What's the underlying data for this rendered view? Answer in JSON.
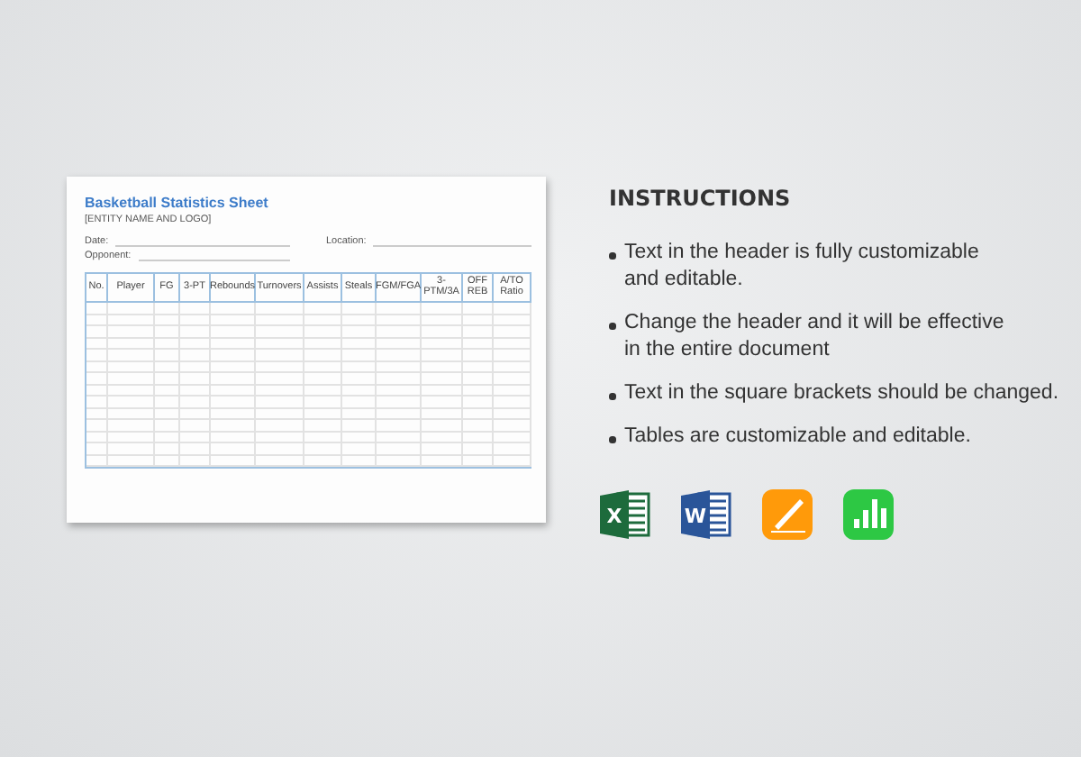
{
  "sheet": {
    "title": "Basketball Statistics Sheet",
    "subtitle": "[ENTITY NAME AND LOGO]",
    "fields": [
      {
        "label": "Date:"
      },
      {
        "label": "Location:"
      },
      {
        "label": "Opponent:"
      }
    ],
    "table": {
      "columns": [
        "No.",
        "Player",
        "FG",
        "3-PT",
        "Rebounds",
        "Turnovers",
        "Assists",
        "Steals",
        "FGM/FGA",
        "3-PTM/3A",
        "OFF REB",
        "A/TO Ratio"
      ]
    }
  },
  "instructions": {
    "title": "INSTRUCTIONS",
    "items": [
      [
        "Text in the header is fully customizable",
        "and editable."
      ],
      [
        "Change the header and it will be effective",
        "in the entire document"
      ],
      [
        "Text in the square brackets should be changed."
      ],
      [
        "Tables are customizable and editable."
      ]
    ]
  },
  "apps": [
    {
      "kind": "excel",
      "letter": "X"
    },
    {
      "kind": "word",
      "letter": "W"
    },
    {
      "kind": "pages"
    },
    {
      "kind": "numbers"
    }
  ]
}
